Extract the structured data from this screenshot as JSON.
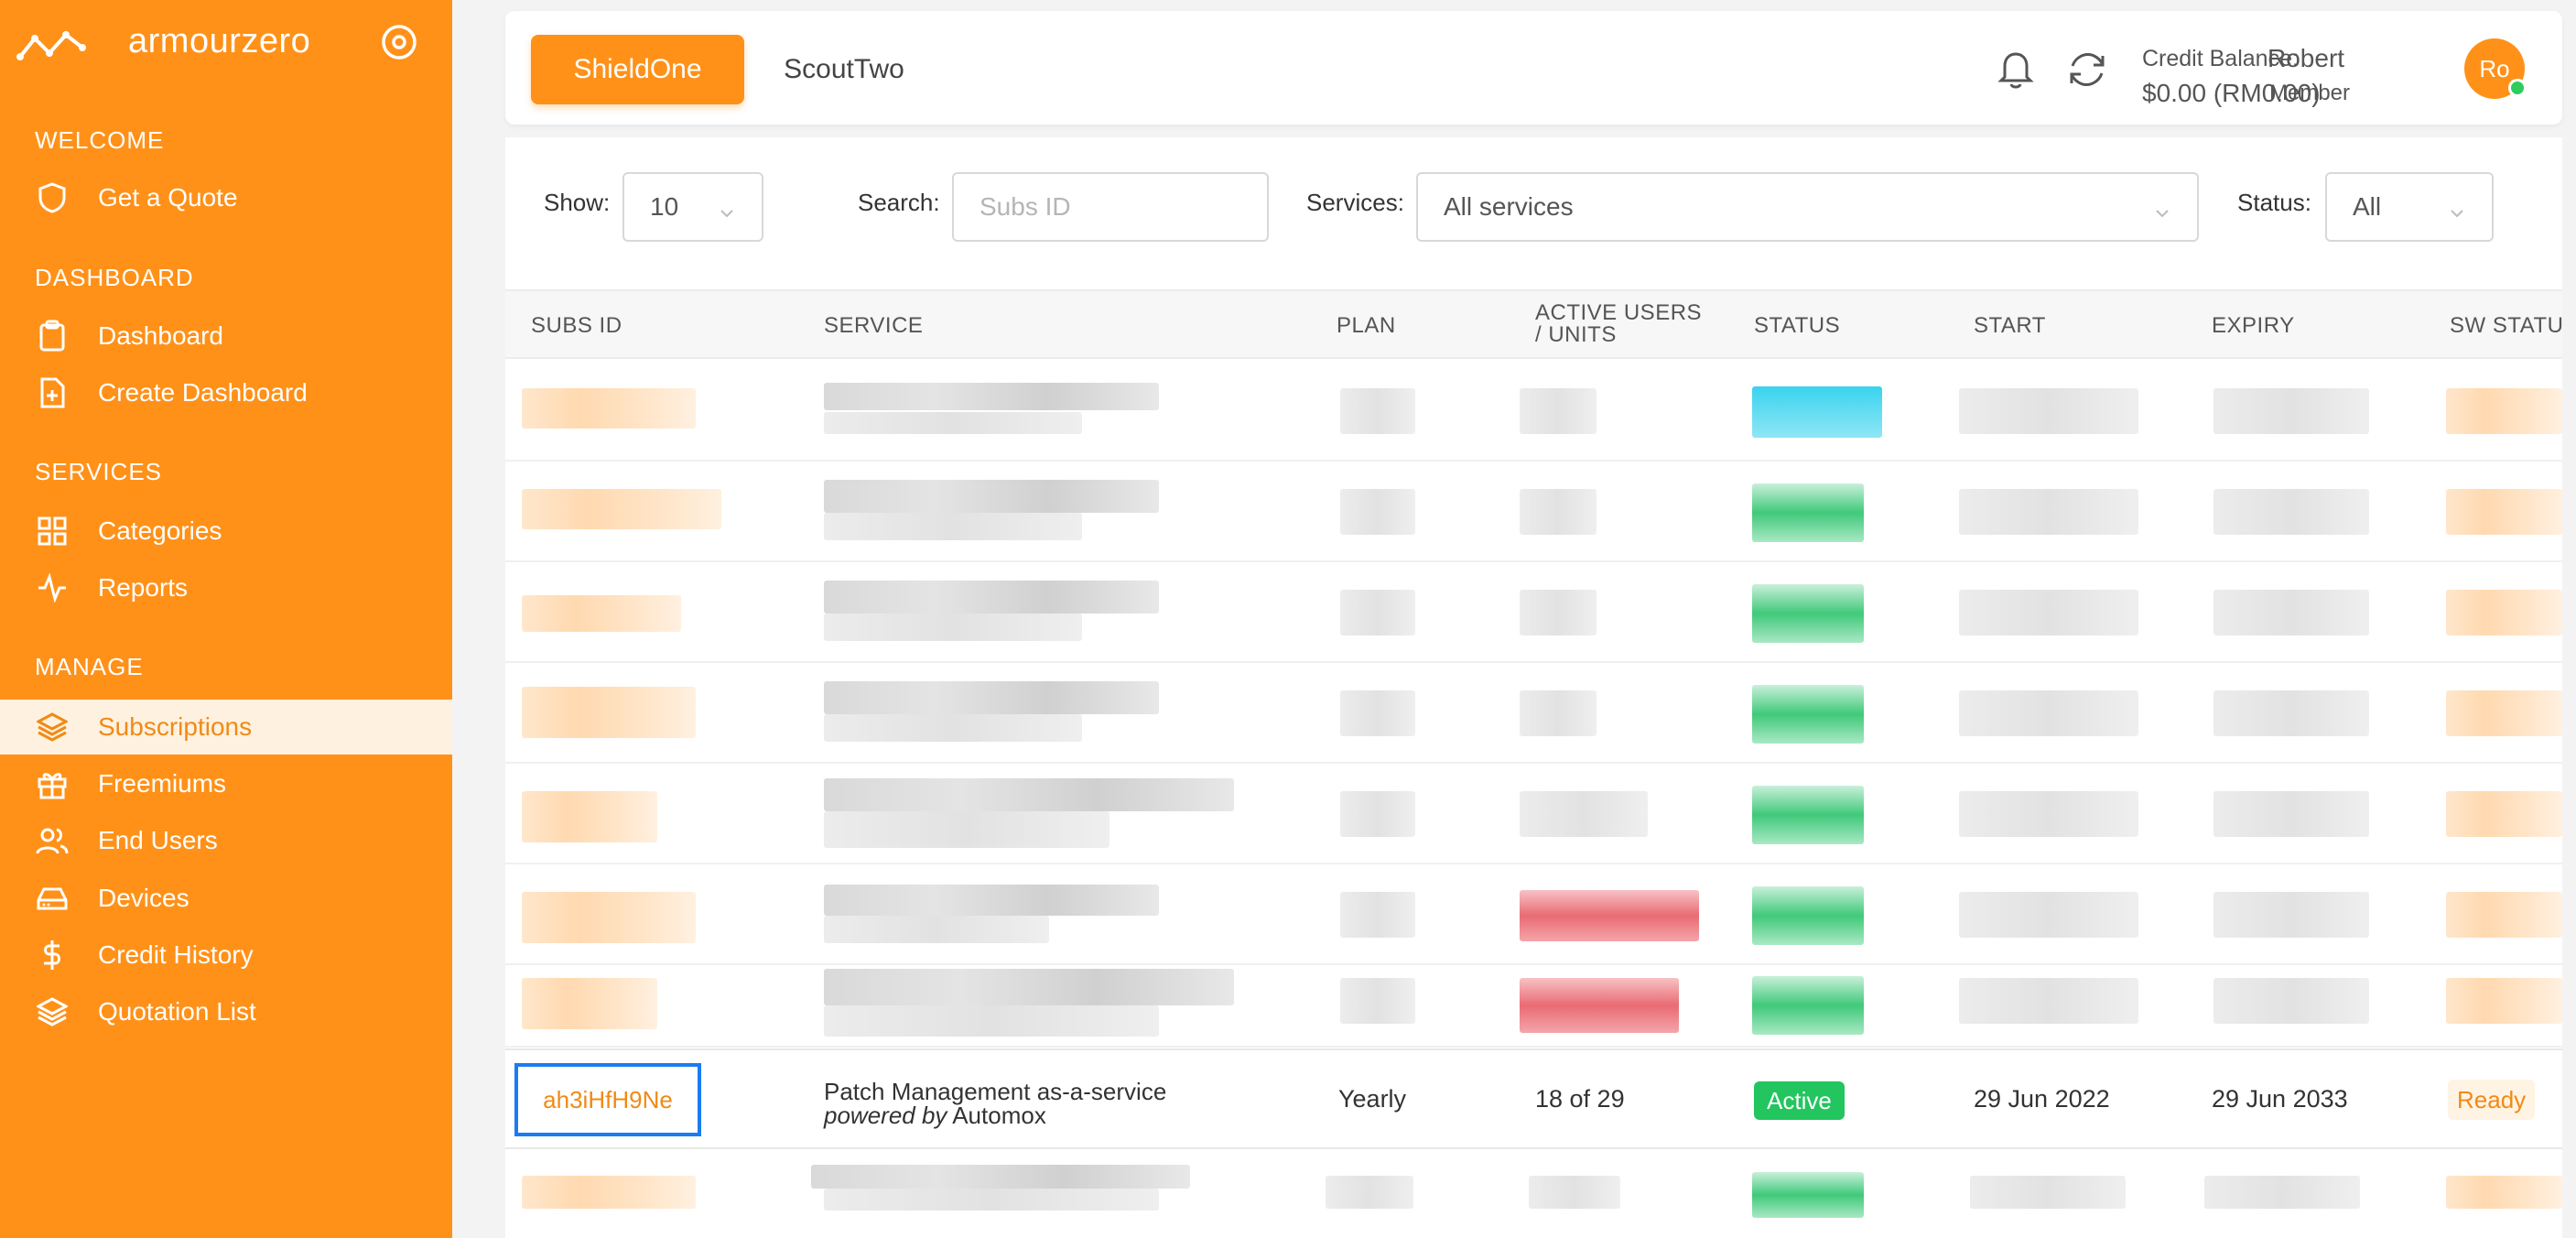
{
  "sidebar": {
    "brand": "armourzero",
    "sections": [
      {
        "heading": "WELCOME",
        "items": [
          {
            "label": "Get a Quote",
            "icon": "shield-icon"
          }
        ]
      },
      {
        "heading": "DASHBOARD",
        "items": [
          {
            "label": "Dashboard",
            "icon": "clipboard-icon"
          },
          {
            "label": "Create Dashboard",
            "icon": "file-plus-icon"
          }
        ]
      },
      {
        "heading": "SERVICES",
        "items": [
          {
            "label": "Categories",
            "icon": "grid-icon"
          },
          {
            "label": "Reports",
            "icon": "activity-icon"
          }
        ]
      },
      {
        "heading": "MANAGE",
        "items": [
          {
            "label": "Subscriptions",
            "icon": "layers-icon",
            "active": true
          },
          {
            "label": "Freemiums",
            "icon": "gift-icon"
          },
          {
            "label": "End Users",
            "icon": "users-icon"
          },
          {
            "label": "Devices",
            "icon": "hard-drive-icon"
          },
          {
            "label": "Credit History",
            "icon": "dollar-icon"
          },
          {
            "label": "Quotation List",
            "icon": "layers-icon"
          }
        ]
      }
    ]
  },
  "topbar": {
    "tabs": [
      {
        "label": "ShieldOne",
        "active": true
      },
      {
        "label": "ScoutTwo",
        "active": false
      }
    ],
    "credit_label": "Credit Balance:",
    "credit_value": "$0.00 (RM0.00)",
    "user_name": "Robert",
    "user_role": "Member",
    "avatar_initials": "Ro"
  },
  "filters": {
    "show_label": "Show:",
    "show_value": "10",
    "search_label": "Search:",
    "search_placeholder": "Subs ID",
    "services_label": "Services:",
    "services_value": "All services",
    "status_label": "Status:",
    "status_value": "All"
  },
  "table": {
    "columns": [
      "SUBS ID",
      "SERVICE",
      "PLAN",
      "ACTIVE USERS",
      "/ UNITS",
      "STATUS",
      "START",
      "EXPIRY",
      "SW STATUS"
    ],
    "highlighted_row": {
      "subs_id": "ah3iHfH9Ne",
      "service_line1": "Patch Management as-a-service",
      "service_powered": "powered by",
      "service_vendor": " Automox",
      "plan": "Yearly",
      "active_users": "18 of 29",
      "status": "Active",
      "start": "29 Jun 2022",
      "expiry": "29 Jun 2033",
      "sw_status": "Ready"
    }
  },
  "colors": {
    "accent": "#ff9119",
    "active_green": "#22c55e",
    "focus_blue": "#1a7cf0"
  }
}
